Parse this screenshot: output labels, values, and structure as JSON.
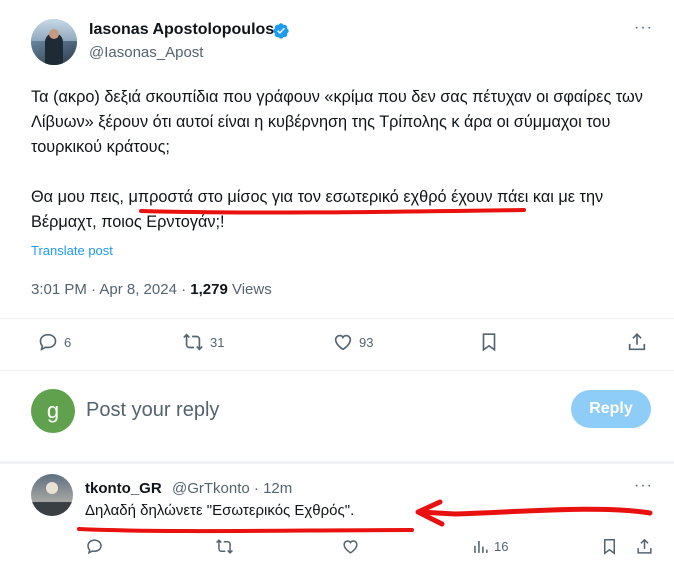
{
  "tweet": {
    "author": {
      "display_name": "Iasonas Apostolopoulos",
      "handle": "@Iasonas_Apost",
      "verified": true
    },
    "paragraphs": [
      "Τα (ακρο) δεξιά σκουπίδια που γράφουν «κρίμα που δεν σας πέτυχαν οι σφαίρες των Λίβυων» ξέρουν ότι αυτοί είναι η κυβέρνηση της Τρίπολης κ άρα οι σύμμαχοι του τουρκικού κράτους;",
      "Θα μου πεις, μπροστά στο μίσος για τον εσωτερικό εχθρό έχουν πάει και με την Βέρμαχτ, ποιος Ερντογάν;!"
    ],
    "translate_label": "Translate post",
    "timestamp": "3:01 PM · Apr 8, 2024 · ",
    "views_count": "1,279",
    "views_label": " Views",
    "more_label": "···",
    "stats": {
      "replies": "6",
      "reposts": "31",
      "likes": "93"
    }
  },
  "composer": {
    "avatar_letter": "g",
    "avatar_color": "#5fa14d",
    "placeholder": "Post your reply",
    "reply_button": "Reply"
  },
  "reply": {
    "display_name": "tkonto_GR",
    "handle_time": "@GrTkonto · 12m",
    "text": "Δηλαδή δηλώνετε \"Εσωτερικός Εχθρός\".",
    "views": "16",
    "more_label": "···"
  },
  "colors": {
    "accent": "#1d9bf0",
    "annotation": "#e8110f",
    "muted": "#536471"
  }
}
